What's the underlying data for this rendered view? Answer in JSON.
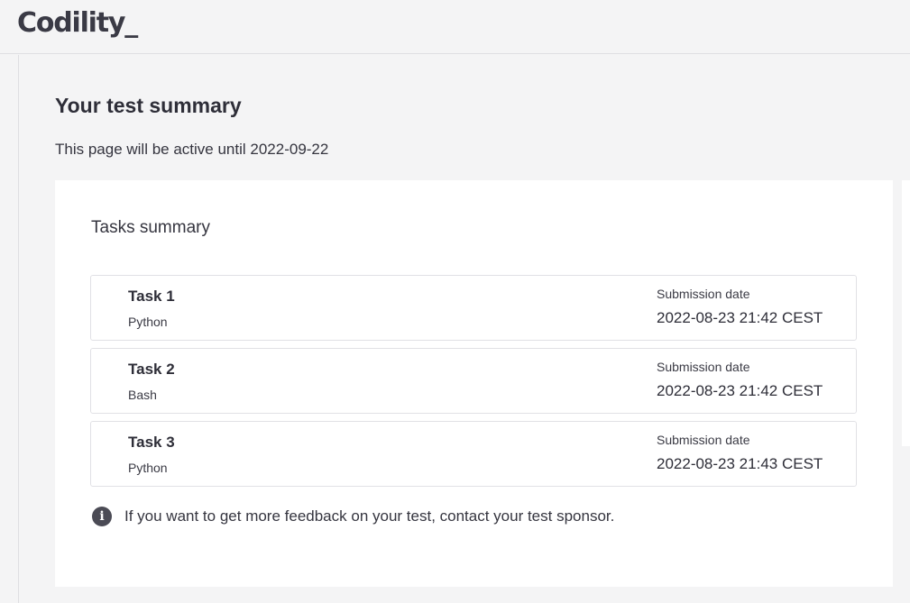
{
  "header": {
    "logo_text": "Codility_"
  },
  "main": {
    "title": "Your test summary",
    "active_note": "This page will be active until 2022-09-22"
  },
  "tasks_summary": {
    "title": "Tasks summary",
    "tasks": [
      {
        "name": "Task 1",
        "language": "Python",
        "submission_label": "Submission date",
        "submission_date": "2022-08-23 21:42 CEST"
      },
      {
        "name": "Task 2",
        "language": "Bash",
        "submission_label": "Submission date",
        "submission_date": "2022-08-23 21:42 CEST"
      },
      {
        "name": "Task 3",
        "language": "Python",
        "submission_label": "Submission date",
        "submission_date": "2022-08-23 21:43 CEST"
      }
    ],
    "feedback_icon": "info-icon",
    "feedback_text": "If you want to get more feedback on your test, contact your test sponsor."
  },
  "colors": {
    "page_background": "#f4f4f5",
    "card_background": "#ffffff",
    "text_primary": "#2e2e38",
    "border": "#e1e1e5",
    "info_icon": "#4b4b55"
  }
}
